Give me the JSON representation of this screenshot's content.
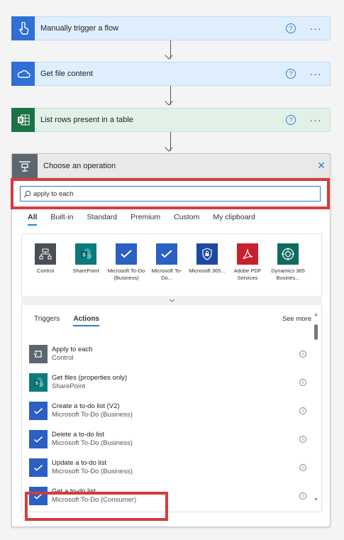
{
  "steps": [
    {
      "title": "Manually trigger a flow",
      "icon": "hand-tap-icon",
      "color": "#2f6fd6"
    },
    {
      "title": "Get file content",
      "icon": "onedrive-cloud-icon",
      "color": "#2f6fd6"
    },
    {
      "title": "List rows present in a table",
      "icon": "excel-icon",
      "color": "#1d7245"
    }
  ],
  "step_help": "?",
  "step_more": "···",
  "panel": {
    "title": "Choose an operation",
    "close": "✕",
    "search": {
      "value": "apply to each",
      "placeholder": ""
    }
  },
  "tabs": [
    "All",
    "Built-in",
    "Standard",
    "Premium",
    "Custom",
    "My clipboard"
  ],
  "connectors": [
    {
      "label": "Control",
      "icon": "control-icon",
      "color": "#4a4f54"
    },
    {
      "label": "SharePoint",
      "icon": "sharepoint-icon",
      "color": "#0b7a7b"
    },
    {
      "label": "Microsoft To-Do (Business)",
      "icon": "todo-check-icon",
      "color": "#2b5fc4"
    },
    {
      "label": "Microsoft To-Do...",
      "icon": "todo-check-icon",
      "color": "#2b5fc4"
    },
    {
      "label": "Microsoft 365...",
      "icon": "shield-lock-icon",
      "color": "#1d4aa0"
    },
    {
      "label": "Adobe PDF Services",
      "icon": "adobe-pdf-icon",
      "color": "#c8202f"
    },
    {
      "label": "Dynamics 365 Busines...",
      "icon": "dynamics-icon",
      "color": "#0f6b5f"
    }
  ],
  "subtabs": [
    "Triggers",
    "Actions"
  ],
  "see_more": "See more",
  "actions": [
    {
      "title": "Apply to each",
      "subtitle": "Control",
      "icon": "loop-icon",
      "color": "#5c6670"
    },
    {
      "title": "Get files (properties only)",
      "subtitle": "SharePoint",
      "icon": "sharepoint-icon",
      "color": "#0b7a7b"
    },
    {
      "title": "Create a to-do list (V2)",
      "subtitle": "Microsoft To-Do (Business)",
      "icon": "todo-check-icon",
      "color": "#2b5fc4"
    },
    {
      "title": "Delete a to-do list",
      "subtitle": "Microsoft To-Do (Business)",
      "icon": "todo-check-icon",
      "color": "#2b5fc4"
    },
    {
      "title": "Update a to-do list",
      "subtitle": "Microsoft To-Do (Business)",
      "icon": "todo-check-icon",
      "color": "#2b5fc4"
    },
    {
      "title": "Get a to-do list",
      "subtitle": "Microsoft To-Do (Consumer)",
      "icon": "todo-check-icon",
      "color": "#2b5fc4"
    }
  ],
  "info": "i"
}
